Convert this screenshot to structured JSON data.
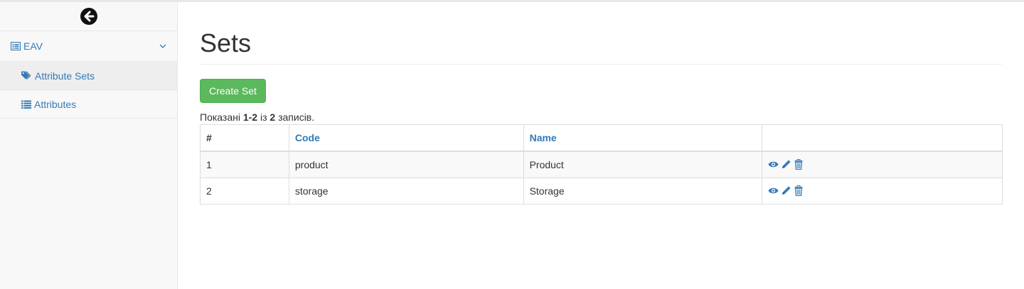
{
  "sidebar": {
    "back_icon": "arrow-circle-left-icon",
    "group": {
      "label": "EAV",
      "icon": "list-alt-icon",
      "chevron": "chevron-down-icon"
    },
    "items": [
      {
        "label": "Attribute Sets",
        "icon": "tags-icon",
        "active": true
      },
      {
        "label": "Attributes",
        "icon": "list-icon",
        "active": false
      }
    ]
  },
  "main": {
    "title": "Sets",
    "create_label": "Create Set",
    "summary": {
      "prefix": "Показані ",
      "range": "1-2",
      "middle": " із ",
      "total": "2",
      "suffix": " записів."
    },
    "table": {
      "headers": [
        "#",
        "Code",
        "Name",
        ""
      ],
      "rows": [
        {
          "num": "1",
          "code": "product",
          "name": "Product"
        },
        {
          "num": "2",
          "code": "storage",
          "name": "Storage"
        }
      ],
      "action_icons": [
        "eye-icon",
        "pencil-icon",
        "trash-icon"
      ]
    }
  },
  "colors": {
    "link": "#337ab7",
    "success": "#5cb85c",
    "sidebar_bg": "#f8f8f8",
    "active_bg": "#eeeeee"
  }
}
